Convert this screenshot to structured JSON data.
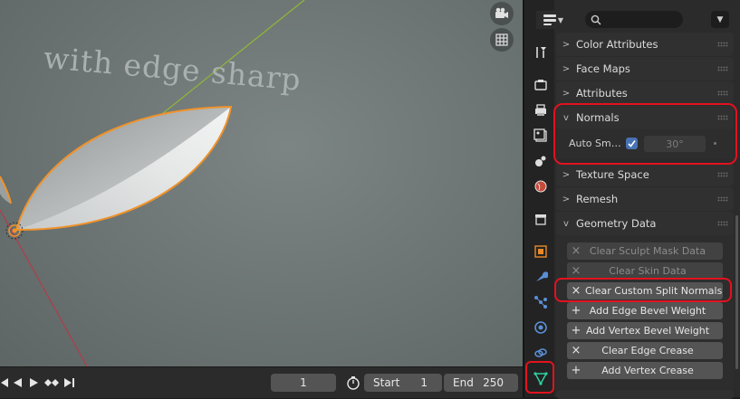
{
  "viewport": {
    "overlay_text": "with edge sharp",
    "nav_icons": [
      "camera-icon",
      "grid-icon"
    ]
  },
  "timeline": {
    "current_frame": "1",
    "start_label": "Start",
    "start_value": "1",
    "end_label": "End",
    "end_value": "250"
  },
  "tabs": [
    "tool-icon",
    "render-icon",
    "output-icon",
    "view-layer-icon",
    "scene-icon",
    "world-icon",
    "collection-icon",
    "object-icon",
    "modifier-icon",
    "particles-icon",
    "physics-icon",
    "constraints-icon",
    "object-data-icon"
  ],
  "search": {
    "placeholder": ""
  },
  "panels": {
    "color_attributes": "Color Attributes",
    "face_maps": "Face Maps",
    "attributes": "Attributes",
    "normals": "Normals",
    "auto_smooth_label": "Auto Sm…",
    "auto_smooth_angle": "30°",
    "texture_space": "Texture Space",
    "remesh": "Remesh",
    "geometry_data": "Geometry Data"
  },
  "geometry_buttons": {
    "clear_sculpt_mask": "Clear Sculpt Mask Data",
    "clear_skin": "Clear Skin Data",
    "clear_custom_split_normals": "Clear Custom Split Normals …",
    "add_edge_bevel": "Add Edge Bevel Weight",
    "add_vertex_bevel": "Add Vertex Bevel Weight",
    "clear_edge_crease": "Clear Edge Crease",
    "add_vertex_crease": "Add Vertex Crease"
  },
  "colors": {
    "highlight_red": "#e2121f",
    "selection_orange": "#f0922a",
    "checkbox_blue": "#4772b3",
    "active_tab_green": "#2fd0a0"
  }
}
